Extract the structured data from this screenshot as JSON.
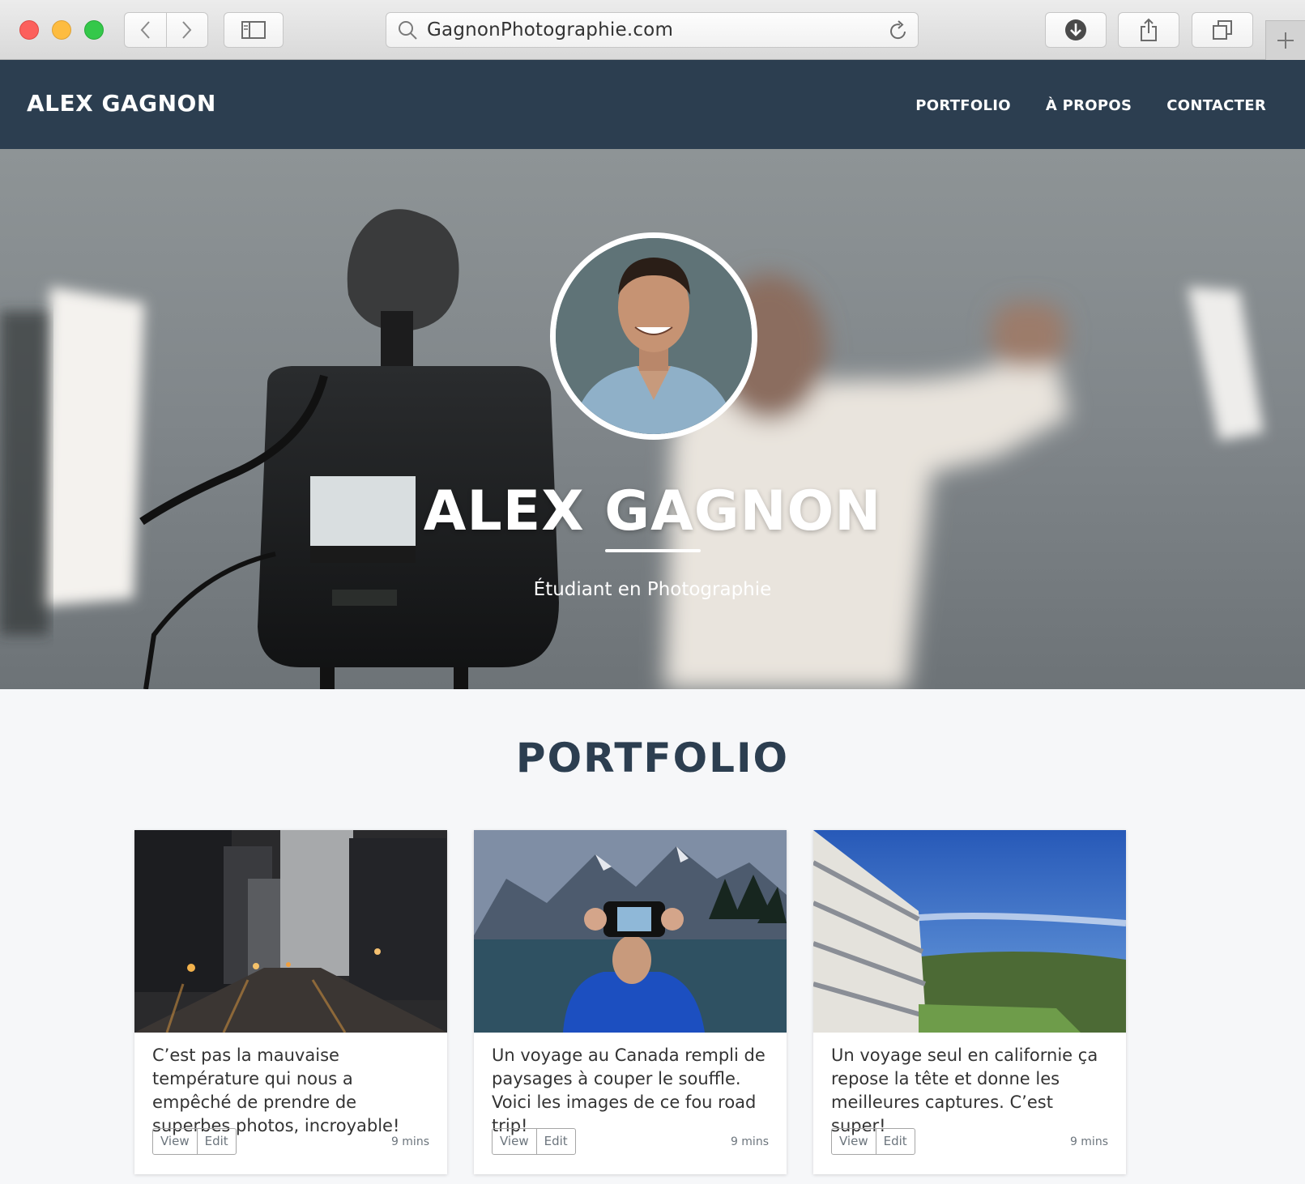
{
  "browser": {
    "url": "GagnonPhotographie.com"
  },
  "site": {
    "brand": "ALEX GAGNON",
    "nav": {
      "portfolio": "PORTFOLIO",
      "about": "À PROPOS",
      "contact": "CONTACTER"
    }
  },
  "hero": {
    "name": "ALEX GAGNON",
    "subtitle": "Étudiant en Photographie"
  },
  "portfolio": {
    "title": "PORTFOLIO",
    "cards": [
      {
        "caption": "C’est pas la mauvaise température qui nous a empêché de prendre de superbes photos, incroyable!",
        "view": "View",
        "edit": "Edit",
        "time": "9 mins"
      },
      {
        "caption": "Un voyage au Canada rempli de paysages à couper le souffle. Voici les images de ce fou road trip!",
        "view": "View",
        "edit": "Edit",
        "time": "9 mins"
      },
      {
        "caption": "Un voyage seul en californie ça repose la tête et donne les meilleures captures. C’est super!",
        "view": "View",
        "edit": "Edit",
        "time": "9 mins"
      }
    ]
  },
  "colors": {
    "navbar": "#2c3e50",
    "heading": "#2c3e50",
    "background": "#f6f7f9"
  }
}
